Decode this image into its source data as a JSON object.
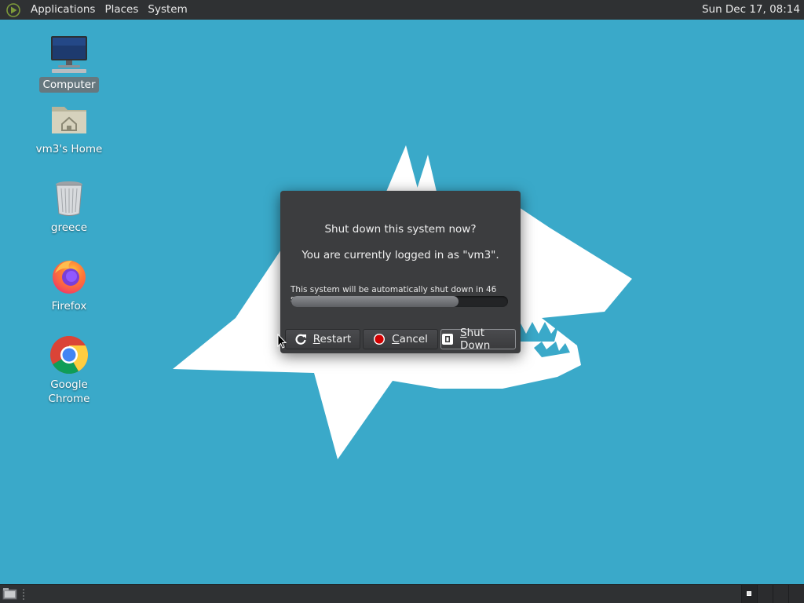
{
  "top_panel": {
    "menus": [
      "Applications",
      "Places",
      "System"
    ],
    "clock": "Sun Dec 17, 08:14"
  },
  "desktop": {
    "icons": [
      {
        "label": "Computer",
        "icon": "computer-icon",
        "selected": true
      },
      {
        "label": "vm3's Home",
        "icon": "home-folder-icon"
      },
      {
        "label": "greece",
        "icon": "trash-icon"
      },
      {
        "label": "Firefox",
        "icon": "firefox-icon"
      },
      {
        "label": "Google Chrome",
        "icon": "chrome-icon"
      }
    ]
  },
  "dialog": {
    "title": "Shut down this system now?",
    "subtitle": "You are currently logged in as \"vm3\".",
    "countdown": "This system will be automatically shut down in 46 seconds",
    "progress_fraction": 0.77,
    "buttons": {
      "restart": {
        "mnemonic": "R",
        "rest": "estart"
      },
      "cancel": {
        "mnemonic": "C",
        "rest": "ancel"
      },
      "shutdown": {
        "mnemonic": "S",
        "rest": "hut Down"
      }
    }
  },
  "colors": {
    "desktop_bg": "#3aa9c9",
    "panel_bg": "#2f3133",
    "dialog_bg": "#3c3d3f",
    "cancel_red": "#d10000"
  }
}
